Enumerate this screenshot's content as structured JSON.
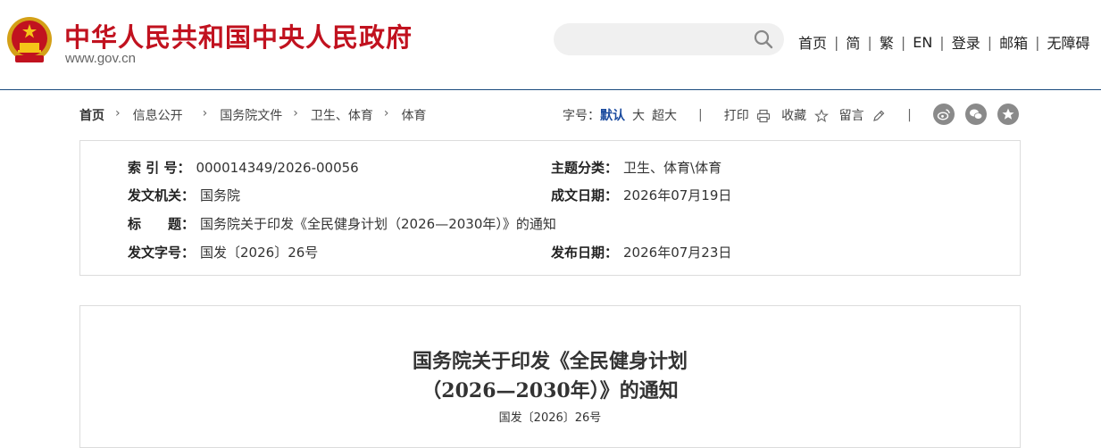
{
  "header": {
    "site_title": "中华人民共和国中央人民政府",
    "site_url": "www.gov.cn",
    "search_placeholder": "",
    "nav": [
      "首页",
      "简",
      "繁",
      "EN",
      "登录",
      "邮箱",
      "无障碍"
    ]
  },
  "breadcrumb": {
    "items": [
      "首页",
      "信息公开",
      "国务院文件",
      "卫生、体育",
      "体育"
    ]
  },
  "tools": {
    "font_label": "字号：",
    "font_default": "默认",
    "font_large": "大",
    "font_xlarge": "超大",
    "print": "打印",
    "favorite": "收藏",
    "comment": "留言"
  },
  "share_icons": [
    "weibo-icon",
    "wechat-icon",
    "star-icon"
  ],
  "info": {
    "index_label": "索 引 号：",
    "index_value": "000014349/2026-00056",
    "topic_label": "主题分类：",
    "topic_value": "卫生、体育\\体育",
    "issuer_label": "发文机关：",
    "issuer_value": "国务院",
    "created_label": "成文日期：",
    "created_value": "2026年07月19日",
    "title_label": "标　　题：",
    "title_value": "国务院关于印发《全民健身计划（2026—2030年）》的通知",
    "docno_label": "发文字号：",
    "docno_value": "国发〔2026〕26号",
    "published_label": "发布日期：",
    "published_value": "2026年07月23日"
  },
  "article": {
    "title_line1": "国务院关于印发《全民健身计划",
    "title_line2": "（2026—2030年）》的通知",
    "doc_number": "国发〔2026〕26号"
  },
  "colors": {
    "brand_red": "#c1121f",
    "accent_blue": "#1a4a9e"
  }
}
